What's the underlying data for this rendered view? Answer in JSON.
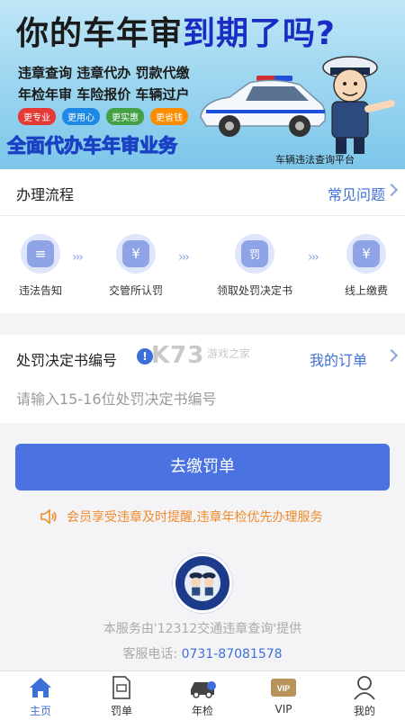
{
  "banner": {
    "title_a": "你的车年审",
    "title_b": "到期了吗?",
    "line1": "违章查询 违章代办 罚款代缴",
    "line2": "年检年审 车险报价 车辆过户",
    "tags": [
      "更专业",
      "更用心",
      "更实惠",
      "更省钱"
    ],
    "tag_colors": [
      "#e53935",
      "#1e88e5",
      "#43a047",
      "#fb8c00"
    ],
    "slogan": "全面代办车年审业务",
    "platform": "车辆违法查询平台"
  },
  "process": {
    "title": "办理流程",
    "faq_label": "常见问题",
    "steps": [
      {
        "label": "违法告知",
        "icon": "notice-icon",
        "glyph": "≡"
      },
      {
        "label": "交管所认罚",
        "icon": "yen-icon",
        "glyph": "¥"
      },
      {
        "label": "领取处罚决定书",
        "icon": "ticket-icon",
        "glyph": "罚"
      },
      {
        "label": "线上缴费",
        "icon": "pay-icon",
        "glyph": "¥"
      }
    ]
  },
  "ticket": {
    "title": "处罚决定书编号",
    "orders_label": "我的订单",
    "placeholder": "请输入15-16位处罚决定书编号",
    "watermark": "K73",
    "watermark_sub": "游戏之家"
  },
  "pay_button": "去缴罚单",
  "vip_notice": "会员享受违章及时提醒,违章年检优先办理服务",
  "footer": {
    "provider": "本服务由'12312交通违章查询'提供",
    "phone_label": "客服电话:",
    "phone": "0731-87081578"
  },
  "tabs": [
    {
      "label": "主页",
      "icon": "home-icon",
      "active": true
    },
    {
      "label": "罚单",
      "icon": "ticket-icon",
      "active": false
    },
    {
      "label": "年检",
      "icon": "car-icon",
      "active": false
    },
    {
      "label": "VIP",
      "icon": "vip-icon",
      "active": false
    },
    {
      "label": "我的",
      "icon": "user-icon",
      "active": false
    }
  ],
  "colors": {
    "accent": "#3e6fd8",
    "button": "#4a72e0",
    "notice": "#f08a2c"
  }
}
